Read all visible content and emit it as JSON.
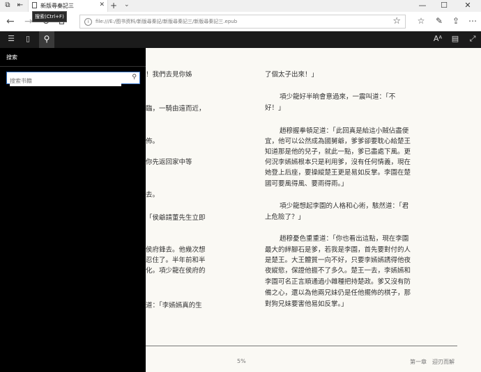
{
  "tab": {
    "title": "新版尋秦記三"
  },
  "addressbar": {
    "url": "file:///E:/图书资料/新版尋秦記/新版尋秦記三/新版尋秦記三.epub",
    "tooltip": "搜索(Ctrl+F)"
  },
  "search_panel": {
    "title": "搜索",
    "placeholder": "搜索书籍"
  },
  "left_column": [
    "！我們去見你姊",
    "臨，一騎由遠而近，",
    "佈。",
    "你先返回家中等",
    "去。",
    "「侯爺請董先生立即",
    "侯府鋒去。他幾次想",
    "忍住了。半年前和半",
    "化。項少龍在侯府的",
    "道：「李嫣嫣真的生"
  ],
  "right_column": [
    "了個太子出來！」",
    "項少龍好半晌會意過來，一震叫道：「不",
    "好！」",
    "趙穆握拳頓足道：「此回真是給這小賊佔盡便",
    "宜，他可以公然成為國舅爺，爹爹卻要耽心給楚王",
    "知道那是他的兒子，就此一點，爹已盡處下風。更",
    "何況李嫣嫣根本只是利用爹，沒有任何情義，現在",
    "她登上后座，要操縱楚王更是易如反掌。李園在楚",
    "國可要風得風、要雨得雨。」",
    "項少龍想起李園的人格和心術，駭然道：「君",
    "上危險了？」",
    "趙穆憂色重重道：「你也看出這點，現在李園",
    "最大的絆腳石是爹，若我是李園，首先要對付的人",
    "是楚王。大王體質一向不好，只要李嫣嫣誘得他夜",
    "夜縱慾，保證他捱不了多久。楚王一去，李嫣嫣和",
    "李園可名正言順通過小雜種把持楚政。爹又沒有防",
    "備之心，還以為他兩兄妹仍是任他擺佈的棋子，那",
    "對狗兄妹要害他易如反掌。」"
  ],
  "footer": {
    "progress": "5%",
    "chapter": "第一章　迎刃而解"
  }
}
